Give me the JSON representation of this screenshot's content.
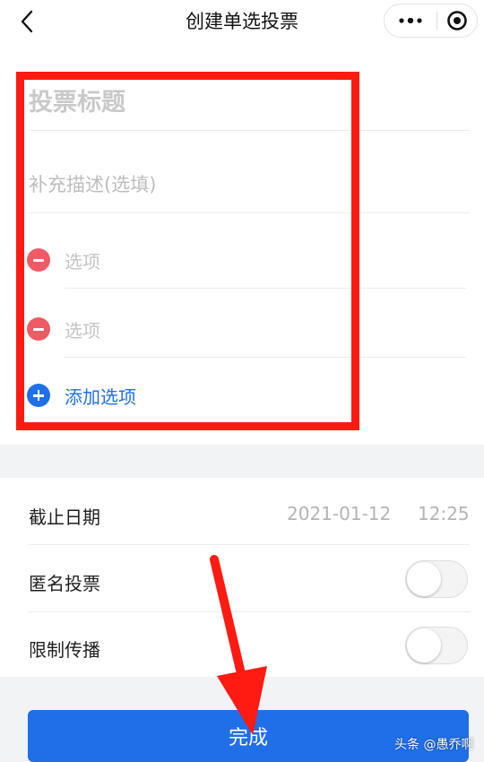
{
  "header": {
    "title": "创建单选投票",
    "icons": [
      "back-arrow-icon",
      "more-dots-icon",
      "mini-program-close-icon"
    ]
  },
  "form": {
    "title_placeholder": "投票标题",
    "description_placeholder": "补充描述(选填)",
    "options": [
      {
        "placeholder": "选项",
        "icon": "remove-circle-icon"
      },
      {
        "placeholder": "选项",
        "icon": "remove-circle-icon"
      }
    ],
    "add_option_label": "添加选项",
    "add_option_icon": "add-circle-icon"
  },
  "settings": {
    "deadline_label": "截止日期",
    "deadline_date": "2021-01-12",
    "deadline_time": "12:25",
    "anonymous_label": "匿名投票",
    "anonymous_enabled": false,
    "limit_share_label": "限制传播",
    "limit_share_enabled": false
  },
  "footer": {
    "done_label": "完成"
  },
  "watermark": "头条 @愚乔啊",
  "colors": {
    "primary": "#1f6fe8",
    "remove": "#f05a64",
    "annotation": "#ff1a12",
    "background": "#f2f3f5"
  }
}
